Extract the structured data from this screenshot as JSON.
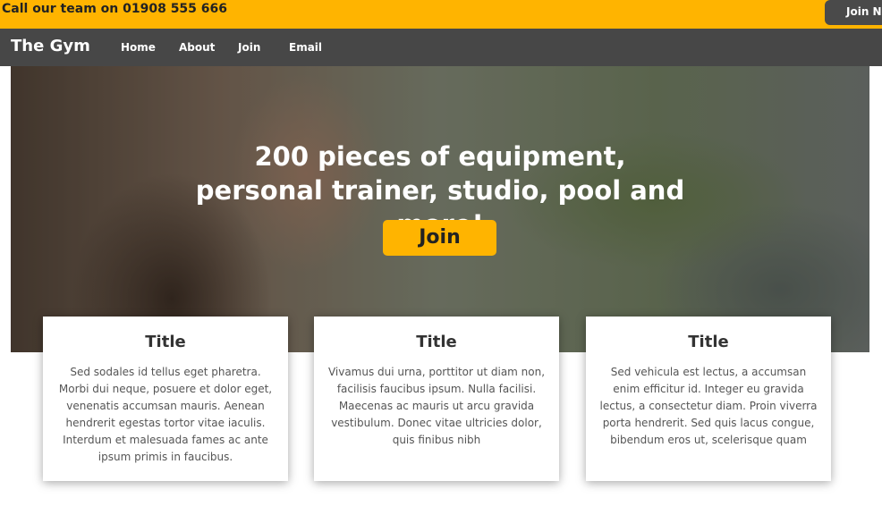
{
  "topbar": {
    "phone_text": "Call our team on 01908 555 666",
    "join_now_label": "Join Now",
    "background": "#ffb400"
  },
  "navbar": {
    "brand": "The Gym",
    "links": [
      "Home",
      "About",
      "Join",
      "Email"
    ],
    "background": "#474747"
  },
  "hero": {
    "headline": "200 pieces of equipment, personal trainer, studio, pool and more!",
    "join_label": "Join",
    "accent": "#ffb400"
  },
  "cards": [
    {
      "title": "Title",
      "text": "Sed sodales id tellus eget pharetra. Morbi dui neque, posuere et dolor eget, venenatis accumsan mauris. Aenean hendrerit egestas tortor vitae iaculis. Interdum et malesuada fames ac ante ipsum primis in faucibus."
    },
    {
      "title": "Title",
      "text": "Vivamus dui urna, porttitor ut diam non, facilisis faucibus ipsum. Nulla facilisi. Maecenas ac mauris ut arcu gravida vestibulum. Donec vitae ultricies dolor, quis finibus nibh"
    },
    {
      "title": "Title",
      "text": "Sed vehicula est lectus, a accumsan enim efficitur id. Integer eu gravida lectus, a consectetur diam. Proin viverra porta hendrerit. Sed quis lacus congue, bibendum eros ut, scelerisque quam"
    }
  ]
}
